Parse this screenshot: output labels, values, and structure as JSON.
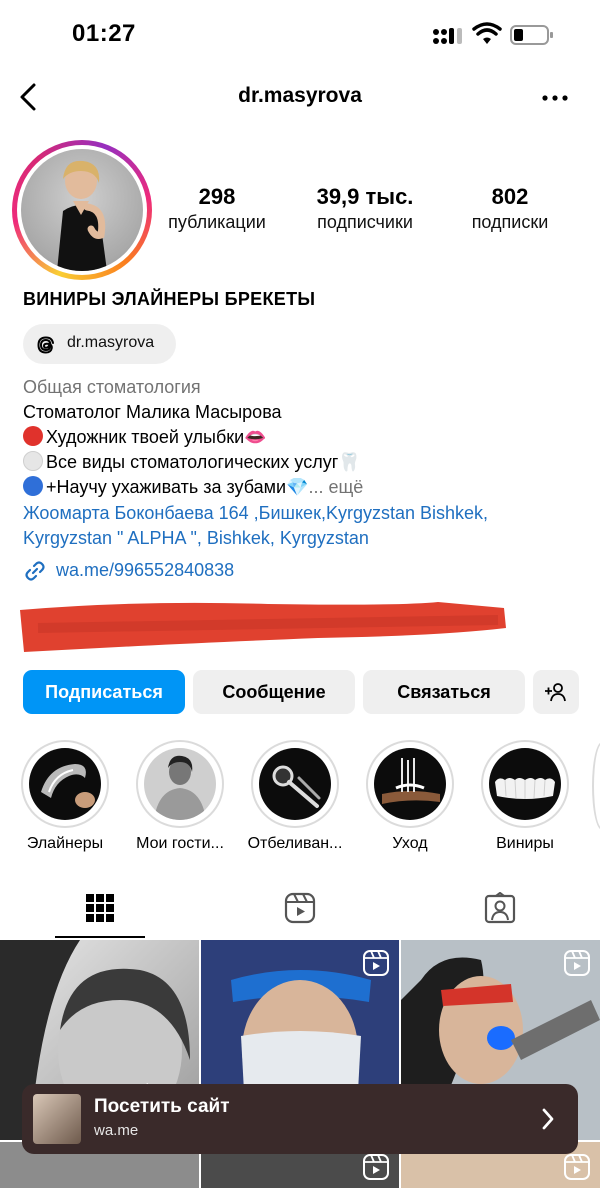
{
  "status_bar": {
    "time": "01:27"
  },
  "nav": {
    "username": "dr.masyrova"
  },
  "profile": {
    "stats": [
      {
        "value": "298",
        "label": "публикации"
      },
      {
        "value": "39,9 тыс.",
        "label": "подписчики"
      },
      {
        "value": "802",
        "label": "подписки"
      }
    ],
    "headline": "ВИНИРЫ ЭЛАЙНЕРЫ БРЕКЕТЫ",
    "threads_handle": "dr.masyrova",
    "category": "Общая стоматология",
    "bio_lines": [
      "Стоматолог Малика Масырова",
      "Художник твоей улыбки👄",
      "Все виды стоматологических услуг🦷",
      "+Научу ухаживать за зубами💎"
    ],
    "more_label": "... ещё",
    "address_lines": [
      "Жоомарта Боконбаева 164 ,Бишкек,Kyrgyzstan Bishkek,",
      "Kyrgyzstan \" ALPHA \", Bishkek, Kyrgyzstan"
    ],
    "link": "wa.me/996552840838"
  },
  "actions": {
    "follow": "Подписаться",
    "message": "Сообщение",
    "contact": "Связаться"
  },
  "highlights": [
    {
      "label": "Элайнеры"
    },
    {
      "label": "Мои гости..."
    },
    {
      "label": "Отбеливан..."
    },
    {
      "label": "Уход"
    },
    {
      "label": "Виниры"
    }
  ],
  "banner": {
    "title": "Посетить сайт",
    "subtitle": "wa.me"
  },
  "colors": {
    "primary_button": "#0095f6",
    "link": "#1f6fc0",
    "redaction": "#e0412f",
    "banner_bg": "#3a2a2a"
  }
}
